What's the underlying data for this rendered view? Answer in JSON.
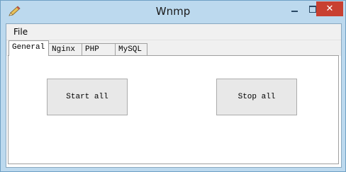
{
  "window": {
    "title": "Wnmp",
    "close_glyph": "✕",
    "icon": "pencil-icon"
  },
  "menu": {
    "items": [
      {
        "label": "File"
      }
    ]
  },
  "tabs": [
    {
      "label": "General",
      "active": true
    },
    {
      "label": "Nginx",
      "active": false
    },
    {
      "label": "PHP",
      "active": false
    },
    {
      "label": "MySQL",
      "active": false
    }
  ],
  "general": {
    "start_label": "Start all",
    "stop_label": "Stop all"
  },
  "colors": {
    "titlebar": "#bcd9ee",
    "close_button": "#c84031"
  }
}
